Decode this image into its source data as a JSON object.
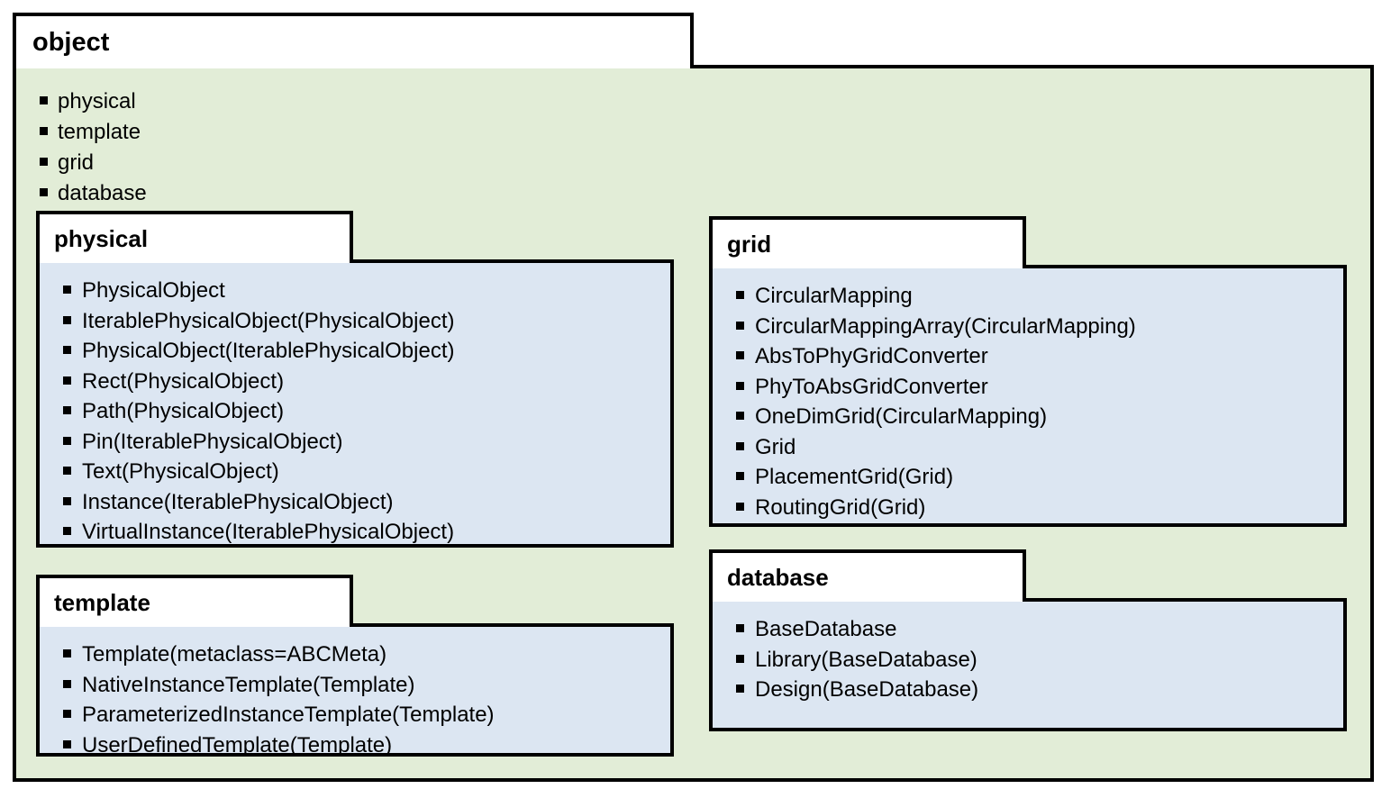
{
  "diagram": {
    "title": "object",
    "colors": {
      "outer_package_fill": "#e2edd7",
      "inner_package_fill": "#dce6f2",
      "tab_fill": "#ffffff",
      "border": "#000000",
      "text": "#000000"
    }
  },
  "object_package": {
    "name": "object",
    "members": [
      "physical",
      "template",
      "grid",
      "database"
    ]
  },
  "physical_package": {
    "name": "physical",
    "members": [
      "PhysicalObject",
      "IterablePhysicalObject(PhysicalObject)",
      "PhysicalObject(IterablePhysicalObject)",
      "Rect(PhysicalObject)",
      "Path(PhysicalObject)",
      "Pin(IterablePhysicalObject)",
      "Text(PhysicalObject)",
      "Instance(IterablePhysicalObject)",
      "VirtualInstance(IterablePhysicalObject)"
    ]
  },
  "template_package": {
    "name": "template",
    "members": [
      "Template(metaclass=ABCMeta)",
      "NativeInstanceTemplate(Template)",
      "ParameterizedInstanceTemplate(Template)",
      "UserDefinedTemplate(Template)"
    ]
  },
  "grid_package": {
    "name": "grid",
    "members": [
      "CircularMapping",
      "CircularMappingArray(CircularMapping)",
      "AbsToPhyGridConverter",
      "PhyToAbsGridConverter",
      "OneDimGrid(CircularMapping)",
      "Grid",
      "PlacementGrid(Grid)",
      "RoutingGrid(Grid)"
    ]
  },
  "database_package": {
    "name": "database",
    "members": [
      "BaseDatabase",
      "Library(BaseDatabase)",
      "Design(BaseDatabase)"
    ]
  }
}
